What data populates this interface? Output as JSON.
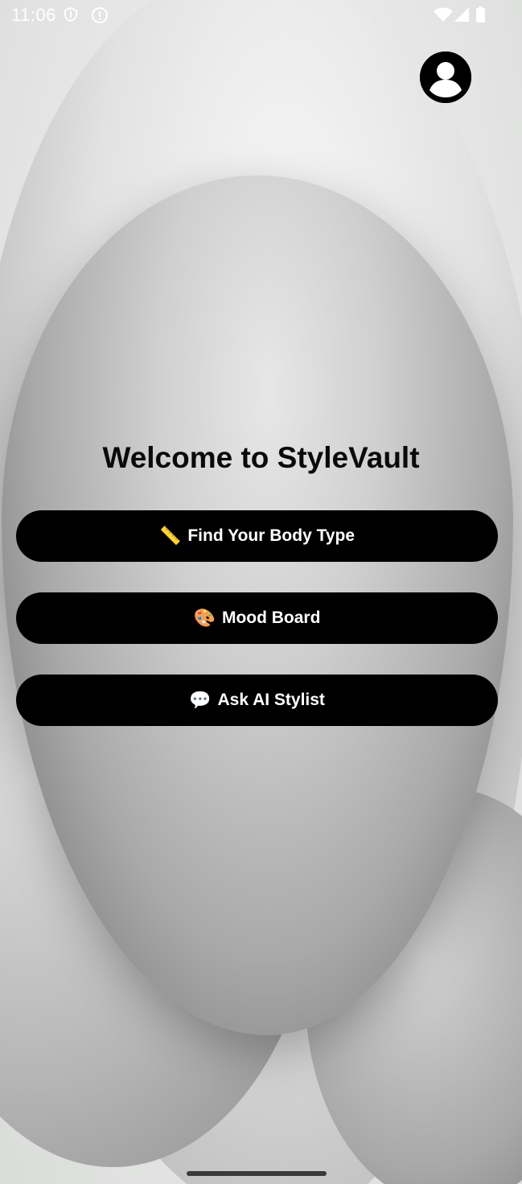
{
  "status_bar": {
    "time": "11:06",
    "icons": [
      "shield-icon",
      "info-icon",
      "wifi-icon",
      "signal-icon",
      "battery-icon"
    ]
  },
  "header": {
    "profile_icon": "account-circle-icon"
  },
  "main": {
    "title": "Welcome to StyleVault",
    "buttons": [
      {
        "emoji": "📏",
        "label": "Find Your Body Type"
      },
      {
        "emoji": "🎨",
        "label": "Mood Board"
      },
      {
        "emoji": "💬",
        "label": "Ask AI Stylist"
      }
    ]
  },
  "colors": {
    "button_bg": "#000000",
    "button_text": "#ffffff",
    "title_text": "#0a0a0a"
  }
}
